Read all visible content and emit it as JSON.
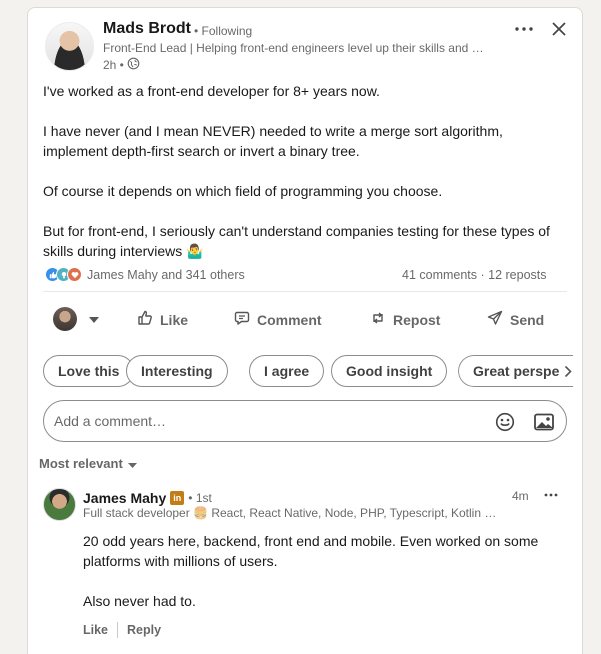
{
  "post": {
    "author": {
      "name": "Mads Brodt",
      "follow_status": "• Following",
      "headline": "Front-End Lead | Helping front-end engineers level up their skills and …",
      "time": "2h •",
      "visibility_icon": "globe-icon"
    },
    "paragraphs": [
      "I've worked as a front-end developer for 8+ years now.",
      "I have never (and I mean NEVER) needed to write a merge sort algorithm, implement depth-first search or invert a binary tree.",
      "Of course it depends on which field of programming you choose.",
      "But for front-end, I seriously can't understand companies testing for these types of skills during interviews 🤷‍♂️"
    ],
    "social": {
      "reaction_icons": [
        "like-reaction-icon",
        "insightful-reaction-icon",
        "love-reaction-icon"
      ],
      "reactors": "James Mahy and 341 others",
      "counts": "41 comments · 12 reposts"
    },
    "actions": {
      "like": "Like",
      "comment": "Comment",
      "repost": "Repost",
      "send": "Send"
    },
    "quick_reactions": [
      "Love this",
      "Interesting",
      "I agree",
      "Good insight",
      "Great perspe"
    ],
    "comment_box": {
      "placeholder": "Add a comment…"
    },
    "sort_label": "Most relevant"
  },
  "comments": [
    {
      "name": "James Mahy",
      "badge": "in",
      "degree": "• 1st",
      "time": "4m",
      "headline": "Full stack developer 🍔 React, React Native, Node, PHP, Typescript, Kotlin …",
      "paragraphs": [
        "20 odd years here, backend, front end and mobile. Even worked on some platforms with millions of users.",
        "Also never had to."
      ],
      "like_label": "Like",
      "reply_label": "Reply"
    }
  ],
  "colors": {
    "accent_blue": "#0a66c2",
    "text_secondary": "#666666",
    "page_bg": "#f4f2ee"
  }
}
